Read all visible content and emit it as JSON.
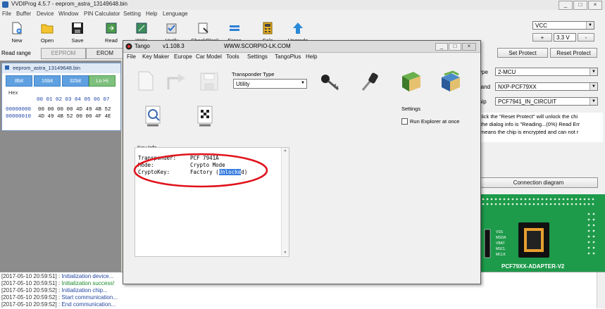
{
  "app": {
    "title": "VVDIProg 4.5.7  -  eeprom_astra_13149648.bin",
    "menu": [
      "File",
      "Buffer",
      "Device",
      "Window",
      "PIN Calculator",
      "Setting",
      "Help",
      "Lenguage"
    ],
    "window_controls": [
      "_",
      "□",
      "×"
    ]
  },
  "toolbar": {
    "items": [
      {
        "label": "New",
        "icon": "new-file-icon"
      },
      {
        "label": "Open",
        "icon": "folder-icon"
      },
      {
        "label": "Save",
        "icon": "floppy-icon"
      },
      {
        "label": "Read",
        "icon": "read-chip-icon"
      },
      {
        "label": "Write",
        "icon": "write-chip-icon"
      },
      {
        "label": "Verify",
        "icon": "verify-icon"
      },
      {
        "label": "CheckBlank",
        "icon": "checkblank-icon"
      },
      {
        "label": "Erase",
        "icon": "erase-icon"
      },
      {
        "label": "Calc",
        "icon": "calculator-icon"
      },
      {
        "label": "Upgrade",
        "icon": "upgrade-arrow-icon"
      }
    ]
  },
  "power": {
    "supply": "VCC",
    "plus": "+",
    "voltage": "3.3 V",
    "minus": "-"
  },
  "read_range": {
    "label": "Read range",
    "tabs": [
      "EEPROM",
      "EROM"
    ]
  },
  "protect": {
    "set": "Set Protect",
    "reset": "Reset Protect"
  },
  "editor": {
    "title": "eeprom_astra_13149648.bin",
    "bit_buttons": [
      "8bit",
      "16bit",
      "32bit",
      "Lo Hi"
    ],
    "hex_label": "Hex",
    "columns": "00 01 02 03 04 05 06 07",
    "rows": [
      {
        "addr": "00000000",
        "bytes": "00 00 00 00 4D 49 4B 52"
      },
      {
        "addr": "00000010",
        "bytes": "4D 49 4B 52 00 00 4F 4E"
      }
    ]
  },
  "device": {
    "type_label": "ype",
    "type": "2-MCU",
    "brand_label": "rand",
    "brand": "NXP-PCF79XX",
    "chip_label": "hip",
    "chip": "PCF7941_IN_CIRCUIT",
    "info_lines": [
      "Click the \"Reset Protect\" will unlock the chi",
      "f the dialog info is \"Reading...(0%) Read Err",
      "t means the chip is encrypted and can not r"
    ],
    "connection_button": "Connection diagram",
    "adapter_label": "PCF79XX-ADAPTER-V2",
    "pin_labels": [
      "VSS",
      "MSDA",
      "VBAT",
      "MSCL",
      "MCLK"
    ]
  },
  "log": [
    {
      "time": "[2017-05-10 20:59:51]",
      "msg": "Initialization device..."
    },
    {
      "time": "[2017-05-10 20:59:51]",
      "msg": "Initialization success!"
    },
    {
      "time": "[2017-05-10 20:59:52]",
      "msg": "Initialization chip..."
    },
    {
      "time": "[2017-05-10 20:59:52]",
      "msg": "Start communication..."
    },
    {
      "time": "[2017-05-10 20:59:52]",
      "msg": "End communication..."
    }
  ],
  "tango": {
    "title": "Tango",
    "version": "v1.108.3",
    "url": "WWW.SCORPIO-LK.COM",
    "menu": [
      "File",
      "Key Maker",
      "Europe",
      "Car Model",
      "Tools",
      "Settings",
      "TangoPlus",
      "Help"
    ],
    "transponder_type_label": "Transponder Type",
    "transponder_type": "Utility",
    "settings_label": "Settings",
    "run_explorer_label": "Run Explorer at once",
    "keyinfo_label": "Key Info",
    "keyinfo_lines": [
      {
        "key": "Transponder:",
        "value": "PCF 7941A"
      },
      {
        "key": "Mode:",
        "value": "Crypto Mode"
      },
      {
        "key": "CryptoKey:",
        "value_pre": "Factory (",
        "value_hl": "Unlocke",
        "value_post": "d)"
      }
    ],
    "colors": {
      "highlight": "#3c7fe0",
      "circle": "#e0121b"
    }
  }
}
